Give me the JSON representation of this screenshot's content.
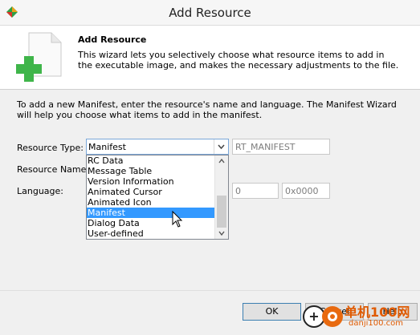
{
  "window": {
    "title": "Add Resource"
  },
  "header": {
    "title": "Add Resource",
    "description": "This wizard lets you selectively choose what resource items to add in the executable image, and makes the necessary adjustments to the file."
  },
  "intro": "To add a new Manifest, enter the resource's name and language. The Manifest Wizard will help you choose what items to add in the manifest.",
  "form": {
    "resource_type_label": "Resource Type:",
    "resource_type_value": "Manifest",
    "resource_type_id": "RT_MANIFEST",
    "resource_name_label": "Resource Name:",
    "language_label": "Language:",
    "language_id": "0",
    "language_hex": "0x0000"
  },
  "dropdown": {
    "options": [
      "RC Data",
      "Message Table",
      "Version Information",
      "Animated Cursor",
      "Animated Icon",
      "Manifest",
      "Dialog Data",
      "User-defined"
    ],
    "selected": "Manifest"
  },
  "buttons": {
    "ok": "OK",
    "cancel": "Cancel",
    "help": "Help"
  },
  "watermark": {
    "line1": "单机100网",
    "line2": "danji100.com"
  }
}
